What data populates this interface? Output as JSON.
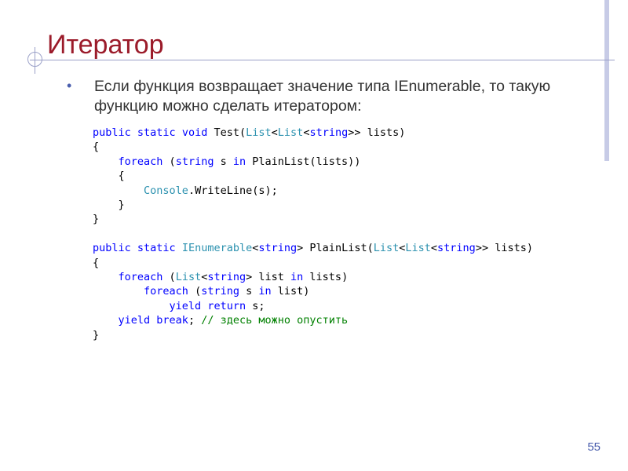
{
  "slide": {
    "title": "Итератор",
    "bullet": "Если функция возвращает значение типа IEnumerable, то такую функцию можно сделать итератором:",
    "page_number": "55"
  },
  "code_lines": [
    [
      {
        "t": "kw",
        "s": "public"
      },
      {
        "t": "p",
        "s": " "
      },
      {
        "t": "kw",
        "s": "static"
      },
      {
        "t": "p",
        "s": " "
      },
      {
        "t": "kw",
        "s": "void"
      },
      {
        "t": "p",
        "s": " Test("
      },
      {
        "t": "ty",
        "s": "List"
      },
      {
        "t": "p",
        "s": "<"
      },
      {
        "t": "ty",
        "s": "List"
      },
      {
        "t": "p",
        "s": "<"
      },
      {
        "t": "kw",
        "s": "string"
      },
      {
        "t": "p",
        "s": ">> lists)"
      }
    ],
    [
      {
        "t": "p",
        "s": "{"
      }
    ],
    [
      {
        "t": "p",
        "s": "    "
      },
      {
        "t": "kw",
        "s": "foreach"
      },
      {
        "t": "p",
        "s": " ("
      },
      {
        "t": "kw",
        "s": "string"
      },
      {
        "t": "p",
        "s": " s "
      },
      {
        "t": "kw",
        "s": "in"
      },
      {
        "t": "p",
        "s": " PlainList(lists))"
      }
    ],
    [
      {
        "t": "p",
        "s": "    {"
      }
    ],
    [
      {
        "t": "p",
        "s": "        "
      },
      {
        "t": "ty",
        "s": "Console"
      },
      {
        "t": "p",
        "s": ".WriteLine(s);"
      }
    ],
    [
      {
        "t": "p",
        "s": "    }"
      }
    ],
    [
      {
        "t": "p",
        "s": "}"
      }
    ],
    [
      {
        "t": "p",
        "s": ""
      }
    ],
    [
      {
        "t": "kw",
        "s": "public"
      },
      {
        "t": "p",
        "s": " "
      },
      {
        "t": "kw",
        "s": "static"
      },
      {
        "t": "p",
        "s": " "
      },
      {
        "t": "ty",
        "s": "IEnumerable"
      },
      {
        "t": "p",
        "s": "<"
      },
      {
        "t": "kw",
        "s": "string"
      },
      {
        "t": "p",
        "s": "> PlainList("
      },
      {
        "t": "ty",
        "s": "List"
      },
      {
        "t": "p",
        "s": "<"
      },
      {
        "t": "ty",
        "s": "List"
      },
      {
        "t": "p",
        "s": "<"
      },
      {
        "t": "kw",
        "s": "string"
      },
      {
        "t": "p",
        "s": ">> lists)"
      }
    ],
    [
      {
        "t": "p",
        "s": "{"
      }
    ],
    [
      {
        "t": "p",
        "s": "    "
      },
      {
        "t": "kw",
        "s": "foreach"
      },
      {
        "t": "p",
        "s": " ("
      },
      {
        "t": "ty",
        "s": "List"
      },
      {
        "t": "p",
        "s": "<"
      },
      {
        "t": "kw",
        "s": "string"
      },
      {
        "t": "p",
        "s": "> list "
      },
      {
        "t": "kw",
        "s": "in"
      },
      {
        "t": "p",
        "s": " lists)"
      }
    ],
    [
      {
        "t": "p",
        "s": "        "
      },
      {
        "t": "kw",
        "s": "foreach"
      },
      {
        "t": "p",
        "s": " ("
      },
      {
        "t": "kw",
        "s": "string"
      },
      {
        "t": "p",
        "s": " s "
      },
      {
        "t": "kw",
        "s": "in"
      },
      {
        "t": "p",
        "s": " list)"
      }
    ],
    [
      {
        "t": "p",
        "s": "            "
      },
      {
        "t": "kw",
        "s": "yield"
      },
      {
        "t": "p",
        "s": " "
      },
      {
        "t": "kw",
        "s": "return"
      },
      {
        "t": "p",
        "s": " s;"
      }
    ],
    [
      {
        "t": "p",
        "s": "    "
      },
      {
        "t": "kw",
        "s": "yield"
      },
      {
        "t": "p",
        "s": " "
      },
      {
        "t": "kw",
        "s": "break"
      },
      {
        "t": "p",
        "s": "; "
      },
      {
        "t": "cm",
        "s": "// здесь можно опустить"
      }
    ],
    [
      {
        "t": "p",
        "s": "}"
      }
    ]
  ],
  "colors": {
    "title": "#9b1b2a",
    "bullet_text": "#333333",
    "keyword": "#0000ff",
    "type": "#2b91af",
    "comment": "#008000",
    "accent": "#4b5fae"
  }
}
